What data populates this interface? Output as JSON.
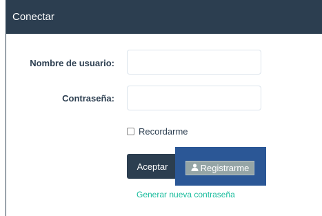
{
  "panel": {
    "title": "Conectar"
  },
  "form": {
    "username_label": "Nombre de usuario:",
    "username_value": "",
    "password_label": "Contraseña:",
    "password_value": "",
    "remember_label": "Recordarme",
    "remember_checked": false,
    "accept_label": "Aceptar",
    "register_label": "Registrarme",
    "register_icon": "user-icon",
    "forgot_link": "Generar nueva contraseña"
  },
  "colors": {
    "header": "#2c3e50",
    "accent_link": "#18bc9c",
    "register_highlight": "#2b5796",
    "register_button": "#95a5a6"
  }
}
